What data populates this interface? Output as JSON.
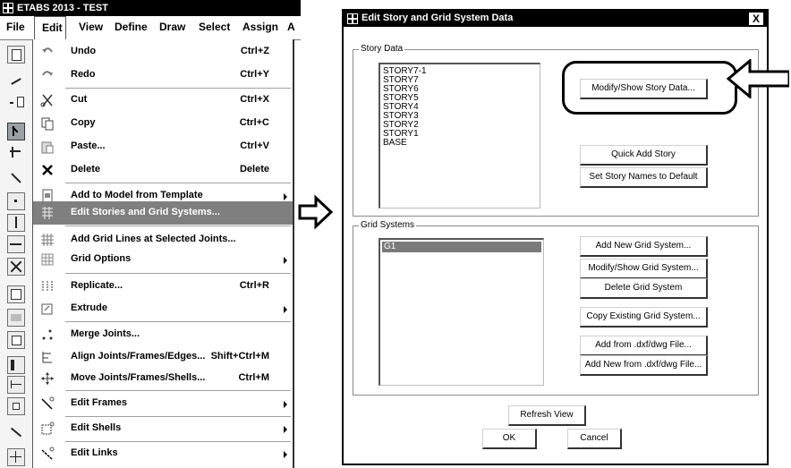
{
  "app": {
    "title": "ETABS 2013 - TEST",
    "menubar": [
      "File",
      "Edit",
      "View",
      "Define",
      "Draw",
      "Select",
      "Assign",
      "A"
    ]
  },
  "edit_menu": {
    "items": [
      {
        "label": "Undo",
        "shortcut": "Ctrl+Z",
        "icon": "undo-icon"
      },
      {
        "label": "Redo",
        "shortcut": "Ctrl+Y",
        "icon": "redo-icon"
      },
      {
        "label": "Cut",
        "shortcut": "Ctrl+X",
        "icon": "cut-icon"
      },
      {
        "label": "Copy",
        "shortcut": "Ctrl+C",
        "icon": "copy-icon"
      },
      {
        "label": "Paste...",
        "shortcut": "Ctrl+V",
        "icon": "paste-icon"
      },
      {
        "label": "Delete",
        "shortcut": "Delete",
        "icon": "delete-icon"
      },
      {
        "label": "Add to Model from Template",
        "shortcut": "",
        "icon": "template-icon",
        "submenu": true
      },
      {
        "label": "Edit Stories and Grid Systems...",
        "shortcut": "",
        "icon": "stories-grid-icon",
        "highlighted": true
      },
      {
        "label": "Add Grid Lines at Selected Joints...",
        "shortcut": "",
        "icon": "grid-lines-icon"
      },
      {
        "label": "Grid Options",
        "shortcut": "",
        "icon": "grid-options-icon",
        "submenu": true
      },
      {
        "label": "Replicate...",
        "shortcut": "Ctrl+R",
        "icon": "replicate-icon"
      },
      {
        "label": "Extrude",
        "shortcut": "",
        "icon": "extrude-icon",
        "submenu": true
      },
      {
        "label": "Merge Joints...",
        "shortcut": "",
        "icon": "merge-joints-icon"
      },
      {
        "label": "Align Joints/Frames/Edges...",
        "shortcut": "Shift+Ctrl+M",
        "icon": "align-icon"
      },
      {
        "label": "Move Joints/Frames/Shells...",
        "shortcut": "Ctrl+M",
        "icon": "move-icon"
      },
      {
        "label": "Edit Frames",
        "shortcut": "",
        "icon": "edit-frames-icon",
        "submenu": true
      },
      {
        "label": "Edit Shells",
        "shortcut": "",
        "icon": "edit-shells-icon",
        "submenu": true
      },
      {
        "label": "Edit Links",
        "shortcut": "",
        "icon": "edit-links-icon",
        "submenu": true
      }
    ]
  },
  "dialog": {
    "title": "Edit Story and Grid System Data",
    "close_label": "X",
    "story_group": {
      "label": "Story Data",
      "stories": [
        "STORY7-1",
        "STORY7",
        "STORY6",
        "STORY5",
        "STORY4",
        "STORY3",
        "STORY2",
        "STORY1",
        "BASE"
      ],
      "buttons": {
        "modify": "Modify/Show Story Data...",
        "quick_add": "Quick Add Story",
        "set_default": "Set Story Names to Default"
      }
    },
    "grid_group": {
      "label": "Grid Systems",
      "systems": [
        "G1"
      ],
      "buttons": {
        "add_new": "Add New Grid System...",
        "modify": "Modify/Show Grid System...",
        "delete": "Delete Grid System",
        "copy": "Copy Existing Grid System...",
        "add_dxf": "Add  from .dxf/dwg File...",
        "add_new_dxf": "Add New from .dxf/dwg File..."
      }
    },
    "refresh_label": "Refresh View",
    "ok_label": "OK",
    "cancel_label": "Cancel"
  }
}
